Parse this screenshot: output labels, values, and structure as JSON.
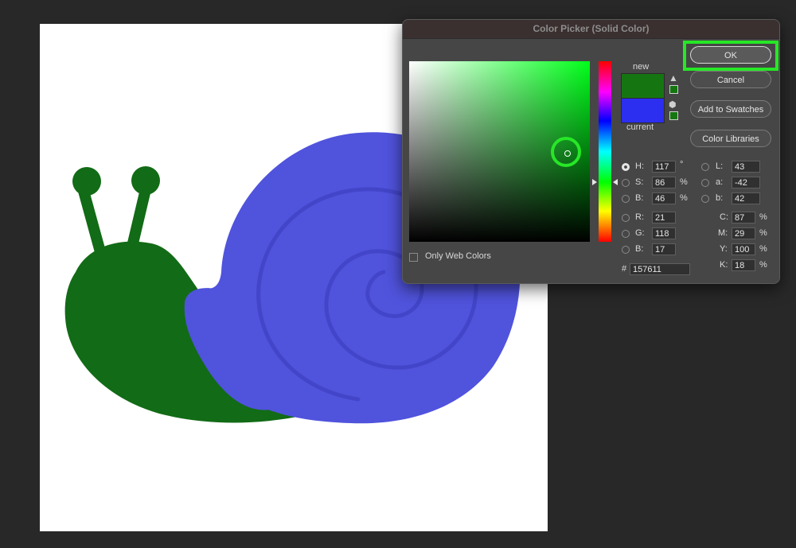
{
  "dialog": {
    "title": "Color Picker (Solid Color)",
    "new_label": "new",
    "current_label": "current",
    "new_color": "#157611",
    "current_color": "#2c2ef0",
    "only_web_colors_label": "Only Web Colors",
    "only_web_colors_checked": false
  },
  "buttons": {
    "ok": "OK",
    "cancel": "Cancel",
    "add_to_swatches": "Add to Swatches",
    "color_libraries": "Color Libraries"
  },
  "fields": {
    "H": {
      "label": "H:",
      "value": "117",
      "unit": "°"
    },
    "S": {
      "label": "S:",
      "value": "86",
      "unit": "%"
    },
    "B": {
      "label": "B:",
      "value": "46",
      "unit": "%"
    },
    "R": {
      "label": "R:",
      "value": "21"
    },
    "G": {
      "label": "G:",
      "value": "118"
    },
    "B2": {
      "label": "B:",
      "value": "17"
    },
    "L": {
      "label": "L:",
      "value": "43"
    },
    "a": {
      "label": "a:",
      "value": "-42"
    },
    "b": {
      "label": "b:",
      "value": "42"
    },
    "C": {
      "label": "C:",
      "value": "87",
      "unit": "%"
    },
    "M": {
      "label": "M:",
      "value": "29",
      "unit": "%"
    },
    "Y": {
      "label": "Y:",
      "value": "100",
      "unit": "%"
    },
    "K": {
      "label": "K:",
      "value": "18",
      "unit": "%"
    },
    "hex": {
      "label": "#",
      "value": "157611"
    }
  },
  "selected_mode": "H",
  "colors": {
    "snail_body": "#126b16",
    "snail_shell": "#5053dc",
    "highlight": "#27e727"
  },
  "icons": {
    "gamut_warning": "warning-triangle-icon",
    "web_safe": "cube-icon"
  }
}
